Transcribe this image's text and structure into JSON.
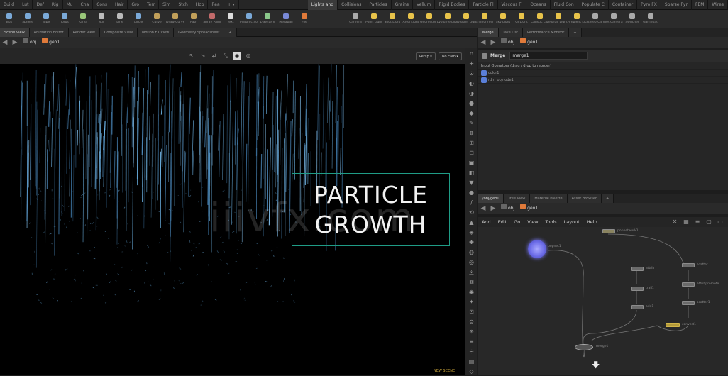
{
  "shelf_tabs": [
    "Build",
    "Lut",
    "Def",
    "Rig",
    "Mu",
    "Cha",
    "Cons",
    "Hair",
    "Gro",
    "Terr",
    "Sim",
    "Stch",
    "Hcp",
    "Rea"
  ],
  "light_tabs": [
    "Lights and",
    "Collisions",
    "Particles",
    "Grains",
    "Vellum",
    "Rigid Bodies",
    "Particle Fl",
    "Viscous Fl",
    "Oceans",
    "Fluid Con",
    "Populate C",
    "Container",
    "Pyro FX",
    "Sparse Pyr",
    "FEM",
    "Wires"
  ],
  "tools_left": [
    {
      "label": "Box",
      "color": "#7aa9d8"
    },
    {
      "label": "Sphere",
      "color": "#7aa9d8"
    },
    {
      "label": "Tube",
      "color": "#7aa9d8"
    },
    {
      "label": "Torus",
      "color": "#7aa9d8"
    },
    {
      "label": "Grid",
      "color": "#9ac77a"
    },
    {
      "label": "Null",
      "color": "#bbbbbb"
    },
    {
      "label": "Line",
      "color": "#bbbbbb"
    },
    {
      "label": "Circle",
      "color": "#7aa9d8"
    },
    {
      "label": "Curve",
      "color": "#c2a05a"
    },
    {
      "label": "Draw Curve",
      "color": "#c2a05a"
    },
    {
      "label": "Path",
      "color": "#c2a05a"
    },
    {
      "label": "Spray Paint",
      "color": "#c26a6a"
    },
    {
      "label": "Text",
      "color": "#dddddd"
    },
    {
      "label": "Platonic Solids",
      "color": "#7aa9d8"
    },
    {
      "label": "L-System",
      "color": "#8ac78a"
    },
    {
      "label": "Metaball",
      "color": "#7a8ad8"
    },
    {
      "label": "File",
      "color": "#e07a3a"
    }
  ],
  "tools_right": [
    {
      "label": "Camera",
      "color": "#aaaaaa"
    },
    {
      "label": "Point Light",
      "color": "#e8c34a"
    },
    {
      "label": "Spot Light",
      "color": "#e8c34a"
    },
    {
      "label": "Area Light",
      "color": "#e8c34a"
    },
    {
      "label": "Geometry Light",
      "color": "#e8c34a"
    },
    {
      "label": "Volume Light",
      "color": "#e8c34a"
    },
    {
      "label": "Distant Light",
      "color": "#e8c34a"
    },
    {
      "label": "Environment Light",
      "color": "#e8c34a"
    },
    {
      "label": "Sky Light",
      "color": "#e8c34a"
    },
    {
      "label": "GI Light",
      "color": "#e8c34a"
    },
    {
      "label": "Caustic Light",
      "color": "#e8c34a"
    },
    {
      "label": "Portal Light",
      "color": "#e8c34a"
    },
    {
      "label": "Ambient Light",
      "color": "#e8c34a"
    },
    {
      "label": "Stereo Camera",
      "color": "#aaaaaa"
    },
    {
      "label": "VR Camera",
      "color": "#aaaaaa"
    },
    {
      "label": "Switcher",
      "color": "#aaaaaa"
    },
    {
      "label": "Gamepad",
      "color": "#aaaaaa"
    }
  ],
  "left_tabs": [
    "Scene View",
    "Animation Editor",
    "Render View",
    "Composite View",
    "Motion FX View",
    "Geometry Spreadsheet"
  ],
  "left_path": {
    "obj": "obj",
    "geo": "geo1"
  },
  "vp_menus": {
    "persp": "Persp",
    "cam": "No cam"
  },
  "right_tabs": [
    "Merge",
    "Take List",
    "Performance Monitor"
  ],
  "right_path": {
    "obj": "obj",
    "geo": "geo1"
  },
  "param": {
    "type": "Merge",
    "name": "merge1",
    "hint": "Input Operators (drag / drop to reorder)",
    "inputs": [
      "color1",
      "rdm_objnode1"
    ]
  },
  "net_tabs": [
    "/obj/geo1",
    "Tree View",
    "Material Palette",
    "Asset Browser"
  ],
  "net_path": {
    "obj": "obj",
    "geo": "geo1"
  },
  "net_menu": [
    "Add",
    "Edit",
    "Go",
    "View",
    "Tools",
    "Layout",
    "Help"
  ],
  "nodes": {
    "pop": "popnet1",
    "top": "popnetwork1",
    "n1": "attrib",
    "n2": "trail1",
    "n3": "add1",
    "n4": "scatter",
    "n5": "attribpromote",
    "n6": "scatter1",
    "n7": "convert1",
    "merge": "merge1"
  },
  "title": {
    "line1": "PARTICLE",
    "line2": "GROWTH"
  },
  "watermark": "iiivfx.com",
  "corner": "NEW SCENE"
}
